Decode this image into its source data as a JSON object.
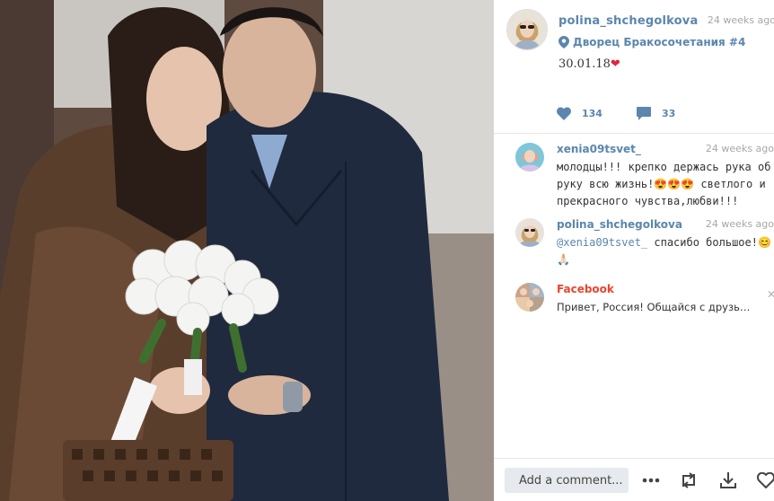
{
  "post": {
    "username": "polina_shchegolkova",
    "time": "24 weeks ago",
    "location": "Дворец Бракосочетания #4",
    "caption": "30.01.18",
    "caption_emoji": "❤",
    "likes": "134",
    "comments": "33"
  },
  "comments": [
    {
      "username": "xenia09tsvet_",
      "time": "24 weeks ago",
      "text": "молодцы!!! крепко держась рука об руку всю жизнь!😍😍😍 светлого и прекрасного чувства,любви!!!"
    },
    {
      "username": "polina_shchegolkova",
      "time": "24 weeks ago",
      "mention": "@xenia09tsvet_",
      "text": " спасибо большое!😊 🙏🏻"
    }
  ],
  "suggestion": {
    "name": "Facebook",
    "text": "Привет, Россия! Общайся с друзьями и близкими"
  },
  "footer": {
    "add_comment": "Add a comment..."
  },
  "colors": {
    "link_blue": "#5b86ad",
    "facebook_red": "#e8462f",
    "heart_red": "#e0243b"
  },
  "icons": [
    "location-pin-icon",
    "like-heart-icon",
    "comment-bubble-icon",
    "more-dots-icon",
    "repost-icon",
    "download-icon",
    "heart-outline-icon",
    "close-icon"
  ]
}
